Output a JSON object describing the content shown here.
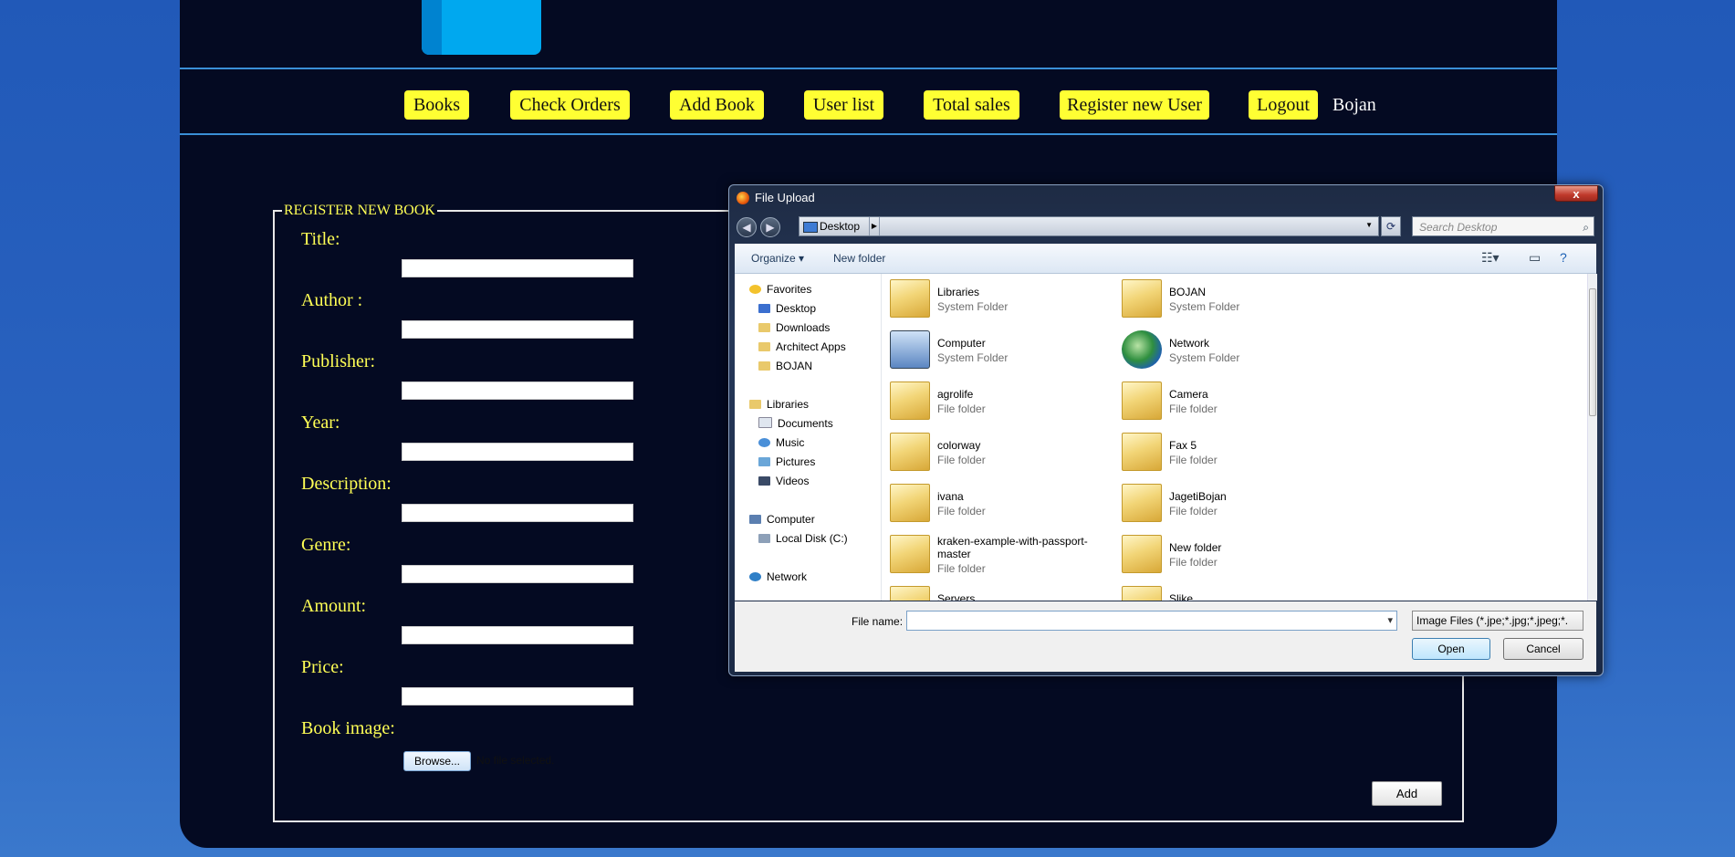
{
  "nav": {
    "items": [
      "Books",
      "Check Orders",
      "Add Book",
      "User list",
      "Total sales",
      "Register new User",
      "Logout"
    ],
    "user": "Bojan"
  },
  "form": {
    "legend": "REGISTER NEW BOOK",
    "labels": [
      "Title:",
      "Author :",
      "Publisher:",
      "Year:",
      "Description:",
      "Genre:",
      "Amount:",
      "Price:",
      "Book image:"
    ],
    "browse_label": "Browse...",
    "no_file_text": "No file selected.",
    "add_label": "Add"
  },
  "dialog": {
    "title": "File Upload",
    "close_label": "x",
    "address": "Desktop",
    "search_placeholder": "Search Desktop",
    "organize_label": "Organize ▾",
    "new_folder_label": "New folder",
    "tree": {
      "favorites": "Favorites",
      "fav_items": [
        "Desktop",
        "Downloads",
        "Architect Apps",
        "BOJAN"
      ],
      "libraries": "Libraries",
      "lib_items": [
        "Documents",
        "Music",
        "Pictures",
        "Videos"
      ],
      "computer": "Computer",
      "comp_items": [
        "Local Disk (C:)"
      ],
      "network": "Network"
    },
    "files": [
      {
        "name": "Libraries",
        "type": "System Folder"
      },
      {
        "name": "BOJAN",
        "type": "System Folder"
      },
      {
        "name": "Computer",
        "type": "System Folder"
      },
      {
        "name": "Network",
        "type": "System Folder"
      },
      {
        "name": "agrolife",
        "type": "File folder"
      },
      {
        "name": "Camera",
        "type": "File folder"
      },
      {
        "name": "colorway",
        "type": "File folder"
      },
      {
        "name": "Fax 5",
        "type": "File folder"
      },
      {
        "name": "ivana",
        "type": "File folder"
      },
      {
        "name": "JagetiBojan",
        "type": "File folder"
      },
      {
        "name": "kraken-example-with-passport-master",
        "type": "File folder"
      },
      {
        "name": "New folder",
        "type": "File folder"
      },
      {
        "name": "Servers",
        "type": ""
      },
      {
        "name": "Slike",
        "type": ""
      }
    ],
    "file_name_label": "File name:",
    "file_name_value": "",
    "file_type": "Image Files (*.jpe;*.jpg;*.jpeg;*.",
    "open_label": "Open",
    "cancel_label": "Cancel"
  }
}
